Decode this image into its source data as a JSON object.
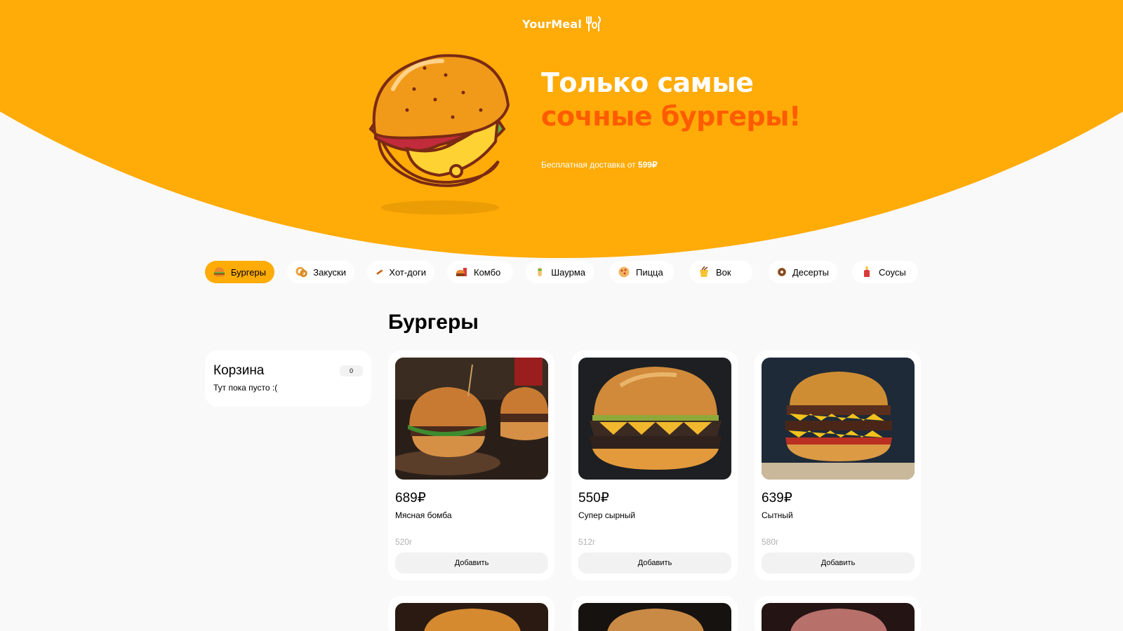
{
  "header": {
    "logo_text": "YourMeal",
    "title_line1": "Только самые",
    "title_line2": "сочные бургеры!",
    "delivery_text": "Бесплатная доставка от ",
    "delivery_amount": "599₽",
    "colors": {
      "brand": "#ffab08",
      "accent": "#ff5c00",
      "background": "#f9f9f9"
    }
  },
  "categories": [
    {
      "label": "Бургеры",
      "icon": "burger-icon",
      "active": true
    },
    {
      "label": "Закуски",
      "icon": "onion-rings-icon",
      "active": false
    },
    {
      "label": "Хот-доги",
      "icon": "hotdog-icon",
      "active": false
    },
    {
      "label": "Комбо",
      "icon": "combo-icon",
      "active": false
    },
    {
      "label": "Шаурма",
      "icon": "shawarma-icon",
      "active": false
    },
    {
      "label": "Пицца",
      "icon": "pizza-icon",
      "active": false
    },
    {
      "label": "Вок",
      "icon": "wok-icon",
      "active": false
    },
    {
      "label": "Десерты",
      "icon": "donut-icon",
      "active": false
    },
    {
      "label": "Соусы",
      "icon": "sauce-icon",
      "active": false
    }
  ],
  "section_title": "Бургеры",
  "cart": {
    "title": "Корзина",
    "count": "0",
    "empty_text": "Тут пока пусто :("
  },
  "products": [
    {
      "price": "689₽",
      "name": "Мясная бомба",
      "weight": "520г",
      "button": "Добавить"
    },
    {
      "price": "550₽",
      "name": "Супер сырный",
      "weight": "512г",
      "button": "Добавить"
    },
    {
      "price": "639₽",
      "name": "Сытный",
      "weight": "580г",
      "button": "Добавить"
    }
  ]
}
